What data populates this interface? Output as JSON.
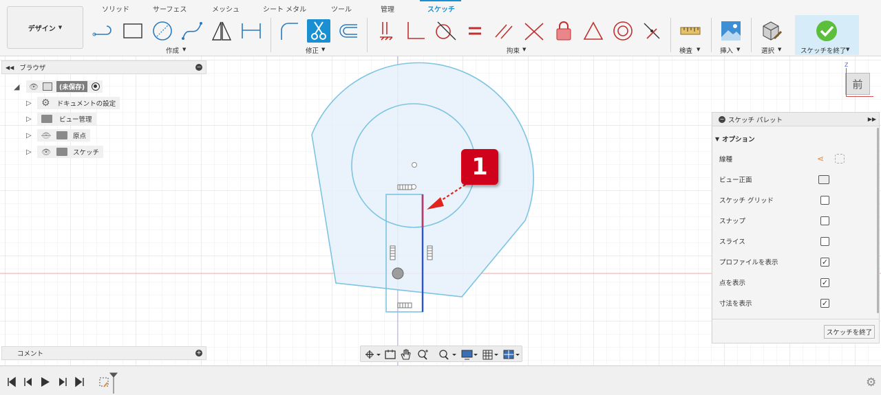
{
  "toolbar": {
    "workspace": "デザイン",
    "tabs": [
      "ソリッド",
      "サーフェス",
      "メッシュ",
      "シート メタル",
      "ツール",
      "管理",
      "スケッチ"
    ],
    "active_tab": "スケッチ",
    "groups": {
      "create": "作成",
      "modify": "修正",
      "constraints": "拘束",
      "inspect": "検査",
      "insert": "挿入",
      "select": "選択",
      "finish": "スケッチを終了"
    },
    "accent_color": "#1a8fd1"
  },
  "browser": {
    "title": "ブラウザ",
    "root": "(未保存)",
    "items": [
      {
        "label": "ドキュメントの設定",
        "icon": "gear-icon"
      },
      {
        "label": "ビュー管理",
        "icon": "folder-icon"
      },
      {
        "label": "原点",
        "icon": "folder-icon"
      },
      {
        "label": "スケッチ",
        "icon": "folder-icon"
      }
    ]
  },
  "comments": {
    "title": "コメント"
  },
  "viewcube": {
    "face": "前",
    "axis": "Z"
  },
  "callout": {
    "number": "1",
    "color": "#d0021b"
  },
  "palette": {
    "title": "スケッチ パレット",
    "section": "オプション",
    "rows": [
      {
        "label": "線種",
        "type": "icon"
      },
      {
        "label": "ビュー正面",
        "type": "icon"
      },
      {
        "label": "スケッチ グリッド",
        "checked": false
      },
      {
        "label": "スナップ",
        "checked": false
      },
      {
        "label": "スライス",
        "checked": false
      },
      {
        "label": "プロファイルを表示",
        "checked": true
      },
      {
        "label": "点を表示",
        "checked": true
      },
      {
        "label": "寸法を表示",
        "checked": true
      }
    ],
    "finish_button": "スケッチを終了"
  }
}
